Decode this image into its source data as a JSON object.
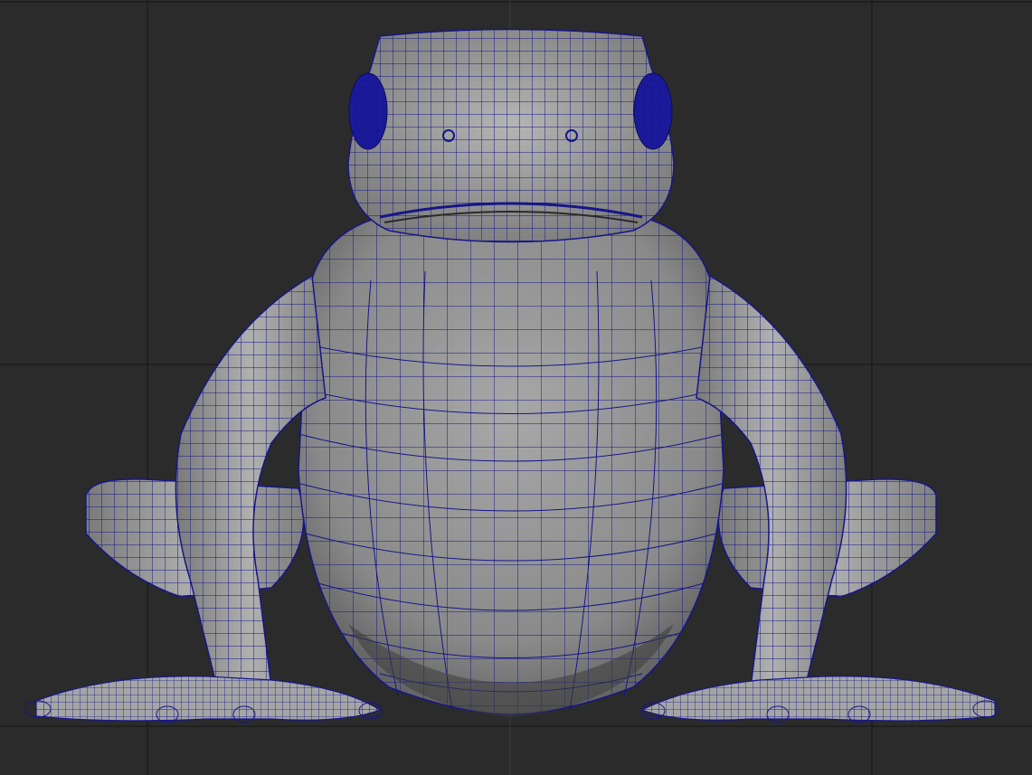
{
  "app": {
    "window_title": ""
  },
  "viewport": {
    "view": "front",
    "display_mode": "wireframe-on-shaded",
    "background_color": "#2b2b2b",
    "grid_color": "#111111",
    "wire_color": "#16168a",
    "surface_color": "#8f8f8f",
    "eye_color": "#1a1a9a"
  },
  "scene": {
    "object": "frog-model",
    "visible_text": ""
  }
}
